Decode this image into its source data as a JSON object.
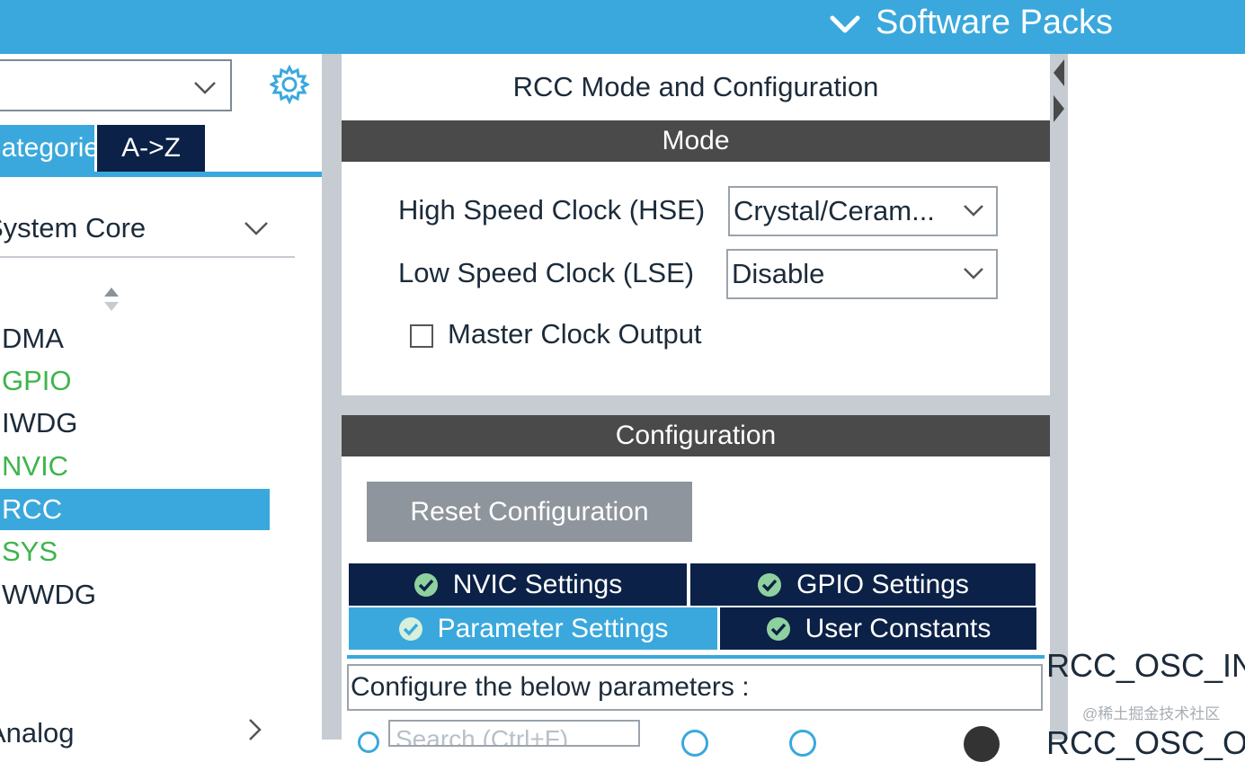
{
  "top_bar": {
    "software_packs_label": "Software Packs",
    "color": "#3aa8dc"
  },
  "left_panel": {
    "search_select_value": "",
    "tabs": {
      "categories_label": "Categories",
      "az_label": "A->Z"
    },
    "system_core_label": "System Core",
    "items": [
      {
        "label": "DMA",
        "status": "dark"
      },
      {
        "label": "GPIO",
        "status": "green"
      },
      {
        "label": "IWDG",
        "status": "dark"
      },
      {
        "label": "NVIC",
        "status": "green"
      },
      {
        "label": "RCC",
        "status": "selected"
      },
      {
        "label": "SYS",
        "status": "green"
      },
      {
        "label": "WWDG",
        "status": "dark"
      }
    ],
    "analog_label": "Analog"
  },
  "main": {
    "title": "RCC Mode and Configuration",
    "mode": {
      "header": "Mode",
      "hse_label": "High Speed Clock (HSE)",
      "hse_value": "Crystal/Ceram...",
      "lse_label": "Low Speed Clock (LSE)",
      "lse_value": "Disable",
      "mco_label": "Master Clock Output",
      "mco_checked": false
    },
    "configuration": {
      "header": "Configuration",
      "reset_label": "Reset Configuration",
      "tabs": {
        "nvic": "NVIC Settings",
        "gpio": "GPIO Settings",
        "param": "Parameter Settings",
        "user": "User Constants"
      },
      "selected_tab": "Parameter Settings",
      "param_prompt": "Configure the below parameters :",
      "search_placeholder": "Search (Ctrl+F)"
    }
  },
  "right_area": {
    "pin_in_label": "RCC_OSC_IN",
    "pin_out_label": "RCC_OSC_OUT",
    "watermark": "@稀土掘金技术社区"
  },
  "colors": {
    "accent": "#3aa8dc",
    "dark_tab": "#0b2147",
    "section_header": "#4a4a4a",
    "status_green": "#3db54a",
    "panel_gap": "#c6ccd2"
  }
}
